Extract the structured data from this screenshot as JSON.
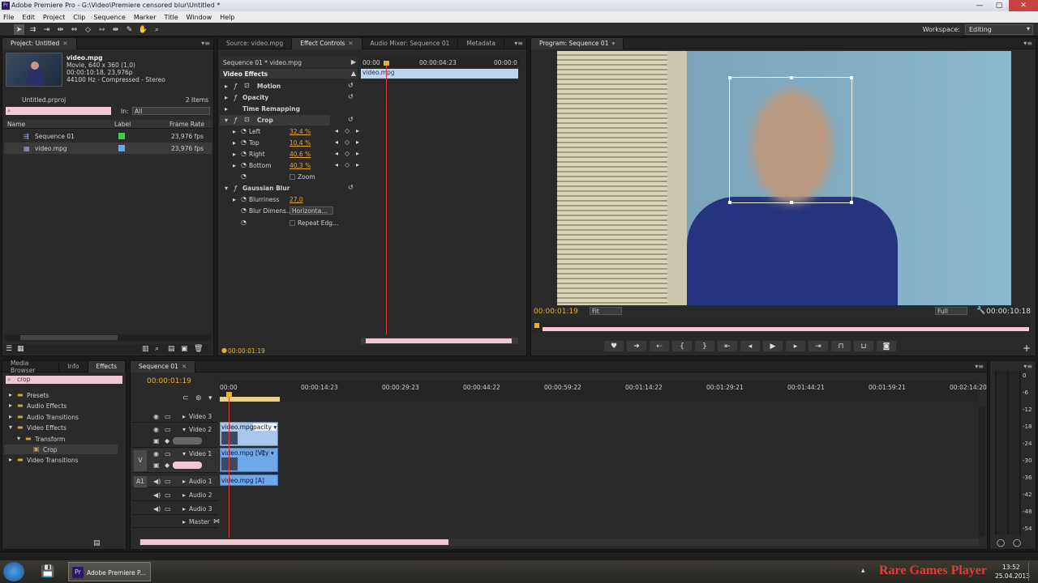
{
  "window": {
    "title": "Adobe Premiere Pro - G:\\Video\\Premiere censored blur\\Untitled *",
    "controls": [
      "—",
      "▢",
      "✕"
    ]
  },
  "menu": [
    "File",
    "Edit",
    "Project",
    "Clip",
    "Sequence",
    "Marker",
    "Title",
    "Window",
    "Help"
  ],
  "toolbar": {
    "tools": [
      "selection-tool",
      "track-select-tool",
      "ripple-edit-tool",
      "rolling-edit-tool",
      "rate-stretch-tool",
      "razor-tool",
      "slip-tool",
      "slide-tool",
      "pen-tool",
      "hand-tool",
      "zoom-tool"
    ],
    "tool_glyphs": [
      "➤",
      "⇉",
      "⇥",
      "⇹",
      "⇔",
      "◇",
      "⇿",
      "⇼",
      "✎",
      "✋",
      "⌕"
    ],
    "workspace_label": "Workspace:",
    "workspace_value": "Editing"
  },
  "project": {
    "tab": "Project: Untitled",
    "clip_name": "video.mpg",
    "clip_line1": "Movie, 640 x 360 (1,0)",
    "clip_line2": "00:00:10:18, 23,976p",
    "clip_line3": "44100 Hz - Compressed - Stereo",
    "file": "Untitled.prproj",
    "items": "2 Items",
    "search_placeholder": "⌕",
    "in_label": "In:",
    "in_value": "All",
    "cols": [
      "Name",
      "Label",
      "Frame Rate"
    ],
    "rows": [
      {
        "name": "Sequence 01",
        "fps": "23,976 fps",
        "color": "#3fcf4a"
      },
      {
        "name": "video.mpg",
        "fps": "23,976 fps",
        "color": "#6ea8e8"
      }
    ]
  },
  "effect_controls": {
    "tabs": [
      "Source: video.mpg",
      "Effect Controls",
      "Audio Mixer: Sequence 01",
      "Metadata"
    ],
    "seq_label": "Sequence 01 * video.mpg",
    "video_effects": "Video Effects",
    "tc_start": "00:00",
    "tc_mid": "00:00:04:23",
    "tc_end": "00:00:0",
    "clip": "video.mpg",
    "motion": "Motion",
    "opacity": "Opacity",
    "time_remap": "Time Remapping",
    "crop": "Crop",
    "crop_props": [
      {
        "name": "Left",
        "value": "32,4 %"
      },
      {
        "name": "Top",
        "value": "10,4 %"
      },
      {
        "name": "Right",
        "value": "40,6 %"
      },
      {
        "name": "Bottom",
        "value": "40,3 %"
      }
    ],
    "zoom": "Zoom",
    "gaussian": "Gaussian Blur",
    "blurriness_label": "Blurriness",
    "blurriness": "27,0",
    "blur_dim_label": "Blur Dimens...",
    "blur_dim": "Horizonta...",
    "repeat_edge": "Repeat Edg...",
    "timecode": "00:00:01:19"
  },
  "program": {
    "tab": "Program: Sequence 01",
    "timecode": "00:00:01:19",
    "fit": "Fit",
    "quality": "Full",
    "duration": "00:00:10:18"
  },
  "effects_panel": {
    "tabs": [
      "Media Browser",
      "Info",
      "Effects"
    ],
    "search": "crop",
    "tree": [
      {
        "label": "Presets",
        "level": 0
      },
      {
        "label": "Audio Effects",
        "level": 0
      },
      {
        "label": "Audio Transitions",
        "level": 0
      },
      {
        "label": "Video Effects",
        "level": 0
      },
      {
        "label": "Transform",
        "level": 1
      },
      {
        "label": "Crop",
        "level": 2
      },
      {
        "label": "Video Transitions",
        "level": 0
      }
    ]
  },
  "timeline": {
    "tab": "Sequence 01",
    "timecode": "00:00:01:19",
    "ruler": [
      "00:00",
      "00:00:14:23",
      "00:00:29:23",
      "00:00:44:22",
      "00:00:59:22",
      "00:01:14:22",
      "00:01:29:21",
      "00:01:44:21",
      "00:01:59:21",
      "00:02:14:20"
    ],
    "tracks": [
      "Video 3",
      "Video 2",
      "Video 1",
      "Audio 1",
      "Audio 2",
      "Audio 3",
      "Master"
    ],
    "v_marker": "V",
    "a_marker": "A1",
    "clip_v2": "video.mpg",
    "clip_v2_fx": "pacity ▾",
    "clip_v1": "video.mpg [V]",
    "clip_v1_fx": "ity ▾",
    "clip_a1": "video.mpg [A]"
  },
  "meter_ticks": [
    "0",
    "-6",
    "-12",
    "-18",
    "-24",
    "-30",
    "-36",
    "-42",
    "-48",
    "-54"
  ],
  "taskbar": {
    "app": "Adobe Premiere P...",
    "brand": "Rare Games Player",
    "time": "13:52",
    "date": "25.04.2013"
  }
}
